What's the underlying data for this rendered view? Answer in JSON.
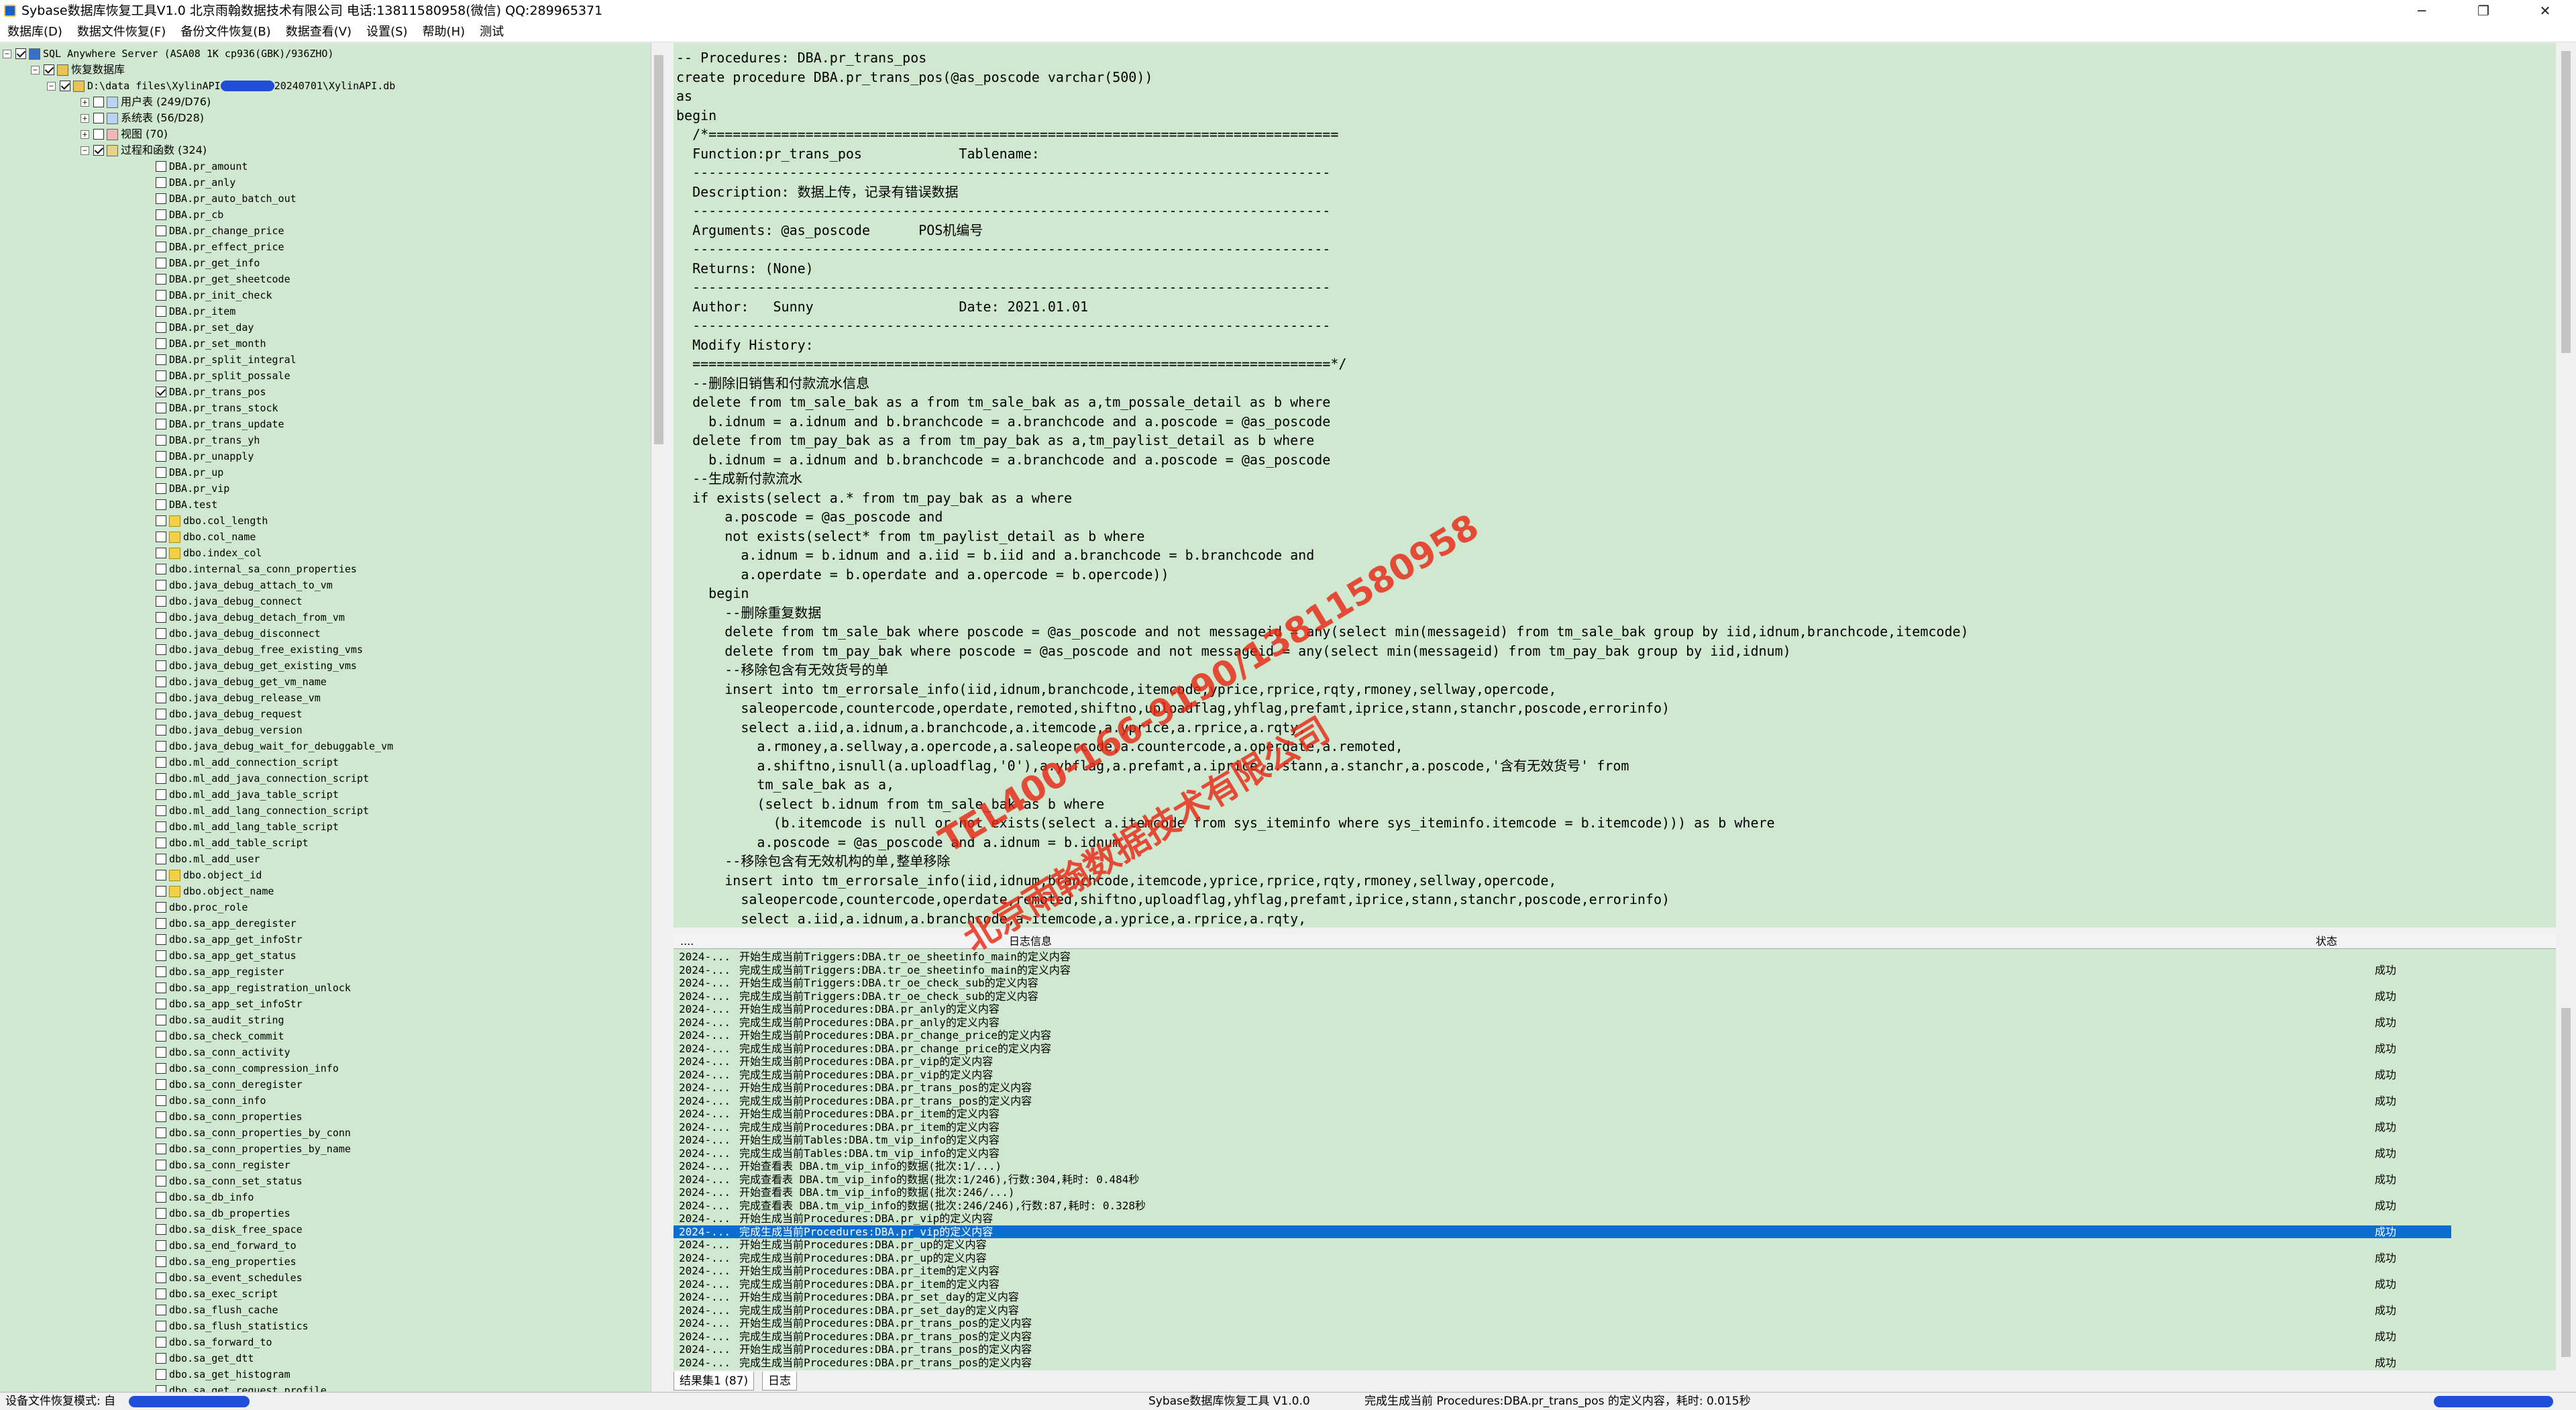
{
  "window": {
    "title": "Sybase数据库恢复工具V1.0    北京雨翰数据技术有限公司  电话:13811580958(微信)   QQ:289965371",
    "minimize": "─",
    "maximize": "❐",
    "close": "✕"
  },
  "menu": [
    "数据库(D)",
    "数据文件恢复(F)",
    "备份文件恢复(B)",
    "数据查看(V)",
    "设置(S)",
    "帮助(H)",
    "测试"
  ],
  "tree": {
    "server": "SQL Anywhere Server (ASA08 1K cp936(GBK)/936ZHO)",
    "root": "恢复数据库",
    "file_prefix": "D:\\data files\\XylinAPI",
    "file_suffix": "20240701\\XylinAPI.db",
    "groups": [
      "用户表 (249/D76)",
      "系统表 (56/D28)",
      "视图 (70)",
      "过程和函数 (324)"
    ],
    "procs": [
      "DBA.pr_amount",
      "DBA.pr_anly",
      "DBA.pr_auto_batch_out",
      "DBA.pr_cb",
      "DBA.pr_change_price",
      "DBA.pr_effect_price",
      "DBA.pr_get_info",
      "DBA.pr_get_sheetcode",
      "DBA.pr_init_check",
      "DBA.pr_item",
      "DBA.pr_set_day",
      "DBA.pr_set_month",
      "DBA.pr_split_integral",
      "DBA.pr_split_possale",
      "DBA.pr_trans_pos",
      "DBA.pr_trans_stock",
      "DBA.pr_trans_update",
      "DBA.pr_trans_yh",
      "DBA.pr_unapply",
      "DBA.pr_up",
      "DBA.pr_vip",
      "DBA.test"
    ],
    "funcs": [
      "dbo.col_length",
      "dbo.col_name",
      "dbo.index_col"
    ],
    "procs2": [
      "dbo.internal_sa_conn_properties",
      "dbo.java_debug_attach_to_vm",
      "dbo.java_debug_connect",
      "dbo.java_debug_detach_from_vm",
      "dbo.java_debug_disconnect",
      "dbo.java_debug_free_existing_vms",
      "dbo.java_debug_get_existing_vms",
      "dbo.java_debug_get_vm_name",
      "dbo.java_debug_release_vm",
      "dbo.java_debug_request",
      "dbo.java_debug_version",
      "dbo.java_debug_wait_for_debuggable_vm",
      "dbo.ml_add_connection_script",
      "dbo.ml_add_java_connection_script",
      "dbo.ml_add_java_table_script",
      "dbo.ml_add_lang_connection_script",
      "dbo.ml_add_lang_table_script",
      "dbo.ml_add_table_script",
      "dbo.ml_add_user"
    ],
    "funcs2": [
      "dbo.object_id",
      "dbo.object_name"
    ],
    "procs3": [
      "dbo.proc_role",
      "dbo.sa_app_deregister",
      "dbo.sa_app_get_infoStr",
      "dbo.sa_app_get_status",
      "dbo.sa_app_register",
      "dbo.sa_app_registration_unlock",
      "dbo.sa_app_set_infoStr",
      "dbo.sa_audit_string",
      "dbo.sa_check_commit",
      "dbo.sa_conn_activity",
      "dbo.sa_conn_compression_info",
      "dbo.sa_conn_deregister",
      "dbo.sa_conn_info",
      "dbo.sa_conn_properties",
      "dbo.sa_conn_properties_by_conn",
      "dbo.sa_conn_properties_by_name",
      "dbo.sa_conn_register",
      "dbo.sa_conn_set_status",
      "dbo.sa_db_info",
      "dbo.sa_db_properties",
      "dbo.sa_disk_free_space",
      "dbo.sa_end_forward_to",
      "dbo.sa_eng_properties",
      "dbo.sa_event_schedules",
      "dbo.sa_exec_script",
      "dbo.sa_flush_cache",
      "dbo.sa_flush_statistics",
      "dbo.sa_forward_to",
      "dbo.sa_get_dtt",
      "dbo.sa_get_histogram",
      "dbo.sa_get_request_profile"
    ]
  },
  "sql": [
    "-- Procedures: DBA.pr_trans_pos",
    "create procedure DBA.pr_trans_pos(@as_poscode varchar(500))",
    "as",
    "begin",
    "  /*==============================================================================",
    "  Function:pr_trans_pos            Tablename:",
    "  -------------------------------------------------------------------------------",
    "  Description: 数据上传，记录有错误数据",
    "  -------------------------------------------------------------------------------",
    "  Arguments: @as_poscode      POS机编号",
    "  -------------------------------------------------------------------------------",
    "  Returns: (None)",
    "  -------------------------------------------------------------------------------",
    "  Author:   Sunny                  Date: 2021.01.01",
    "  -------------------------------------------------------------------------------",
    "  Modify History:",
    "  ===============================================================================*/",
    "  --删除旧销售和付款流水信息",
    "  delete from tm_sale_bak as a from tm_sale_bak as a,tm_possale_detail as b where",
    "    b.idnum = a.idnum and b.branchcode = a.branchcode and a.poscode = @as_poscode",
    "  delete from tm_pay_bak as a from tm_pay_bak as a,tm_paylist_detail as b where",
    "    b.idnum = a.idnum and b.branchcode = a.branchcode and a.poscode = @as_poscode",
    "  --生成新付款流水",
    "  if exists(select a.* from tm_pay_bak as a where",
    "      a.poscode = @as_poscode and",
    "      not exists(select* from tm_paylist_detail as b where",
    "        a.idnum = b.idnum and a.iid = b.iid and a.branchcode = b.branchcode and",
    "        a.operdate = b.operdate and a.opercode = b.opercode))",
    "    begin",
    "      --删除重复数据",
    "      delete from tm_sale_bak where poscode = @as_poscode and not messageid = any(select min(messageid) from tm_sale_bak group by iid,idnum,branchcode,itemcode)",
    "      delete from tm_pay_bak where poscode = @as_poscode and not messageid = any(select min(messageid) from tm_pay_bak group by iid,idnum)",
    "      --移除包含有无效货号的单",
    "      insert into tm_errorsale_info(iid,idnum,branchcode,itemcode,yprice,rprice,rqty,rmoney,sellway,opercode,",
    "        saleopercode,countercode,operdate,remoted,shiftno,uploadflag,yhflag,prefamt,iprice,stann,stanchr,poscode,errorinfo)",
    "        select a.iid,a.idnum,a.branchcode,a.itemcode,a.yprice,a.rprice,a.rqty,",
    "          a.rmoney,a.sellway,a.opercode,a.saleopercode,a.countercode,a.operdate,a.remoted,",
    "          a.shiftno,isnull(a.uploadflag,'0'),a.yhflag,a.prefamt,a.iprice,a.stann,a.stanchr,a.poscode,'含有无效货号' from",
    "          tm_sale_bak as a,",
    "          (select b.idnum from tm_sale_bak as b where",
    "            (b.itemcode is null or not exists(select a.itemcode from sys_iteminfo where sys_iteminfo.itemcode = b.itemcode))) as b where",
    "          a.poscode = @as_poscode and a.idnum = b.idnum",
    "      --移除包含有无效机构的单,整单移除",
    "      insert into tm_errorsale_info(iid,idnum,branchcode,itemcode,yprice,rprice,rqty,rmoney,sellway,opercode,",
    "        saleopercode,countercode,operdate,remoted,shiftno,uploadflag,yhflag,prefamt,iprice,stann,stanchr,poscode,errorinfo)",
    "        select a.iid,a.idnum,a.branchcode,a.itemcode,a.yprice,a.rprice,a.rqty,"
  ],
  "log": {
    "col_time": "....",
    "col_msg": "日志信息",
    "col_status": "状态",
    "rows": [
      [
        "2024-...",
        "开始生成当前Triggers:DBA.tr_oe_sheetinfo_main的定义内容",
        ""
      ],
      [
        "2024-...",
        "完成生成当前Triggers:DBA.tr_oe_sheetinfo_main的定义内容",
        "成功"
      ],
      [
        "2024-...",
        "开始生成当前Triggers:DBA.tr_oe_check_sub的定义内容",
        ""
      ],
      [
        "2024-...",
        "完成生成当前Triggers:DBA.tr_oe_check_sub的定义内容",
        "成功"
      ],
      [
        "2024-...",
        "开始生成当前Procedures:DBA.pr_anly的定义内容",
        ""
      ],
      [
        "2024-...",
        "完成生成当前Procedures:DBA.pr_anly的定义内容",
        "成功"
      ],
      [
        "2024-...",
        "开始生成当前Procedures:DBA.pr_change_price的定义内容",
        ""
      ],
      [
        "2024-...",
        "完成生成当前Procedures:DBA.pr_change_price的定义内容",
        "成功"
      ],
      [
        "2024-...",
        "开始生成当前Procedures:DBA.pr_vip的定义内容",
        ""
      ],
      [
        "2024-...",
        "完成生成当前Procedures:DBA.pr_vip的定义内容",
        "成功"
      ],
      [
        "2024-...",
        "开始生成当前Procedures:DBA.pr_trans_pos的定义内容",
        ""
      ],
      [
        "2024-...",
        "完成生成当前Procedures:DBA.pr_trans_pos的定义内容",
        "成功"
      ],
      [
        "2024-...",
        "开始生成当前Procedures:DBA.pr_item的定义内容",
        ""
      ],
      [
        "2024-...",
        "完成生成当前Procedures:DBA.pr_item的定义内容",
        "成功"
      ],
      [
        "2024-...",
        "开始生成当前Tables:DBA.tm_vip_info的定义内容",
        ""
      ],
      [
        "2024-...",
        "完成生成当前Tables:DBA.tm_vip_info的定义内容",
        "成功"
      ],
      [
        "2024-...",
        "开始查看表 DBA.tm_vip_info的数据(批次:1/...)",
        ""
      ],
      [
        "2024-...",
        "完成查看表 DBA.tm_vip_info的数据(批次:1/246),行数:304,耗时: 0.484秒",
        "成功"
      ],
      [
        "2024-...",
        "开始查看表 DBA.tm_vip_info的数据(批次:246/...)",
        ""
      ],
      [
        "2024-...",
        "完成查看表 DBA.tm_vip_info的数据(批次:246/246),行数:87,耗时: 0.328秒",
        "成功"
      ],
      [
        "2024-...",
        "开始生成当前Procedures:DBA.pr_vip的定义内容",
        ""
      ],
      [
        "2024-...",
        "完成生成当前Procedures:DBA.pr_vip的定义内容",
        "成功"
      ],
      [
        "2024-...",
        "开始生成当前Procedures:DBA.pr_up的定义内容",
        ""
      ],
      [
        "2024-...",
        "完成生成当前Procedures:DBA.pr_up的定义内容",
        "成功"
      ],
      [
        "2024-...",
        "开始生成当前Procedures:DBA.pr_item的定义内容",
        ""
      ],
      [
        "2024-...",
        "完成生成当前Procedures:DBA.pr_item的定义内容",
        "成功"
      ],
      [
        "2024-...",
        "开始生成当前Procedures:DBA.pr_set_day的定义内容",
        ""
      ],
      [
        "2024-...",
        "完成生成当前Procedures:DBA.pr_set_day的定义内容",
        "成功"
      ],
      [
        "2024-...",
        "开始生成当前Procedures:DBA.pr_trans_pos的定义内容",
        ""
      ],
      [
        "2024-...",
        "完成生成当前Procedures:DBA.pr_trans_pos的定义内容",
        "成功"
      ],
      [
        "2024-...",
        "开始生成当前Procedures:DBA.pr_trans_pos的定义内容",
        ""
      ],
      [
        "2024-...",
        "完成生成当前Procedures:DBA.pr_trans_pos的定义内容",
        "成功"
      ]
    ],
    "selected_index": 21
  },
  "tabs": {
    "result": "结果集1 (87)",
    "log": "日志"
  },
  "status": {
    "mode_label": "设备文件恢复模式: 自",
    "app": "Sybase数据库恢复工具 V1.0.0",
    "msg": "完成生成当前 Procedures:DBA.pr_trans_pos 的定义内容，耗时: 0.015秒"
  },
  "watermark": {
    "line1": "TEL400-166-9190/13811580958",
    "line2": "北京雨翰数据技术有限公司"
  },
  "colors": {
    "pane_bg": "#cfe8cf",
    "selection": "#0a6ed1",
    "watermark": "#e62814",
    "redaction": "#1e4fd6"
  }
}
